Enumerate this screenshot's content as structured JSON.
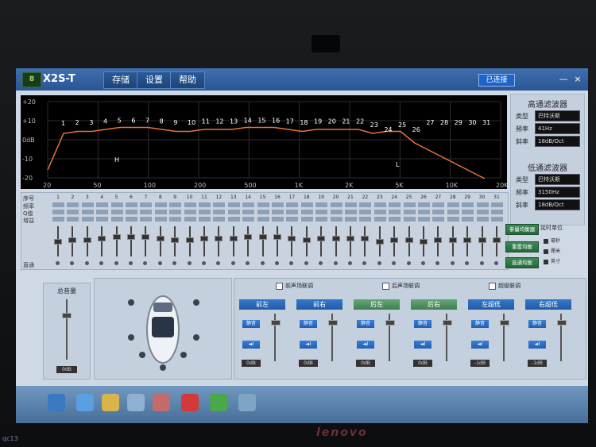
{
  "app": {
    "logo_text": "8",
    "title": "X2S-T",
    "status": "已连接",
    "minimize": "—",
    "close": "×"
  },
  "menu": [
    "存储",
    "设置",
    "帮助"
  ],
  "graph": {
    "y_ticks": [
      "+20",
      "+10",
      "0dB",
      "-10",
      "-20"
    ],
    "x_ticks": [
      "20",
      "50",
      "100",
      "200",
      "500",
      "1K",
      "2K",
      "5K",
      "10K",
      "20K"
    ],
    "band_labels": [
      "1",
      "2",
      "3",
      "4",
      "5",
      "6",
      "7",
      "8",
      "9",
      "10",
      "11",
      "12",
      "13",
      "14",
      "15",
      "16",
      "17",
      "18",
      "19",
      "20",
      "21",
      "22",
      "23",
      "24",
      "25",
      "26",
      "27",
      "28",
      "29",
      "30",
      "31"
    ],
    "marker_h": "H",
    "marker_l": "L"
  },
  "highpass": {
    "title": "高通滤波器",
    "type_label": "类型",
    "type_value": "巴特沃斯",
    "freq_label": "频率",
    "freq_value": "41Hz",
    "slope_label": "斜率",
    "slope_value": "18dB/Oct"
  },
  "lowpass": {
    "title": "低通滤波器",
    "type_label": "类型",
    "type_value": "巴特沃斯",
    "freq_label": "频率",
    "freq_value": "3150Hz",
    "slope_label": "斜率",
    "slope_value": "18dB/Oct"
  },
  "eq": {
    "seq_label": "序号",
    "freq_label": "频率",
    "q_label": "Q值",
    "gain_label": "增益",
    "through_label": "直通",
    "bands": [
      "1",
      "2",
      "3",
      "4",
      "5",
      "6",
      "7",
      "8",
      "9",
      "10",
      "11",
      "12",
      "13",
      "14",
      "15",
      "16",
      "17",
      "18",
      "19",
      "20",
      "21",
      "22",
      "23",
      "24",
      "25",
      "26",
      "27",
      "28",
      "29",
      "30",
      "31"
    ],
    "gains": [
      0,
      1,
      1,
      2,
      3,
      3,
      3,
      2,
      1,
      1,
      2,
      2,
      2,
      3,
      3,
      3,
      2,
      1,
      2,
      2,
      2,
      2,
      0,
      1,
      1,
      0,
      1,
      1,
      1,
      1,
      1
    ]
  },
  "side_buttons": [
    "参量均衡器",
    "重置均衡",
    "直通均衡"
  ],
  "delay": {
    "title": "延时单位",
    "options": [
      "毫秒",
      "厘米",
      "英寸"
    ]
  },
  "volume": {
    "label": "总音量",
    "value": "0dB",
    "level": 0.78
  },
  "links": [
    "前声场联调",
    "后声场联调",
    "超级联调"
  ],
  "channels": [
    {
      "name": "前左",
      "mute": "静音",
      "value": "0dB"
    },
    {
      "name": "前右",
      "mute": "静音",
      "value": "0dB"
    },
    {
      "name": "后左",
      "mute": "静音",
      "value": "0dB"
    },
    {
      "name": "后右",
      "mute": "静音",
      "value": "0dB"
    },
    {
      "name": "左超低",
      "mute": "静音",
      "value": "-1dB"
    },
    {
      "name": "右超低",
      "mute": "静音",
      "value": "-1dB"
    }
  ],
  "bottom": {
    "lenovo": "lenovo",
    "watermark": "qc13"
  }
}
